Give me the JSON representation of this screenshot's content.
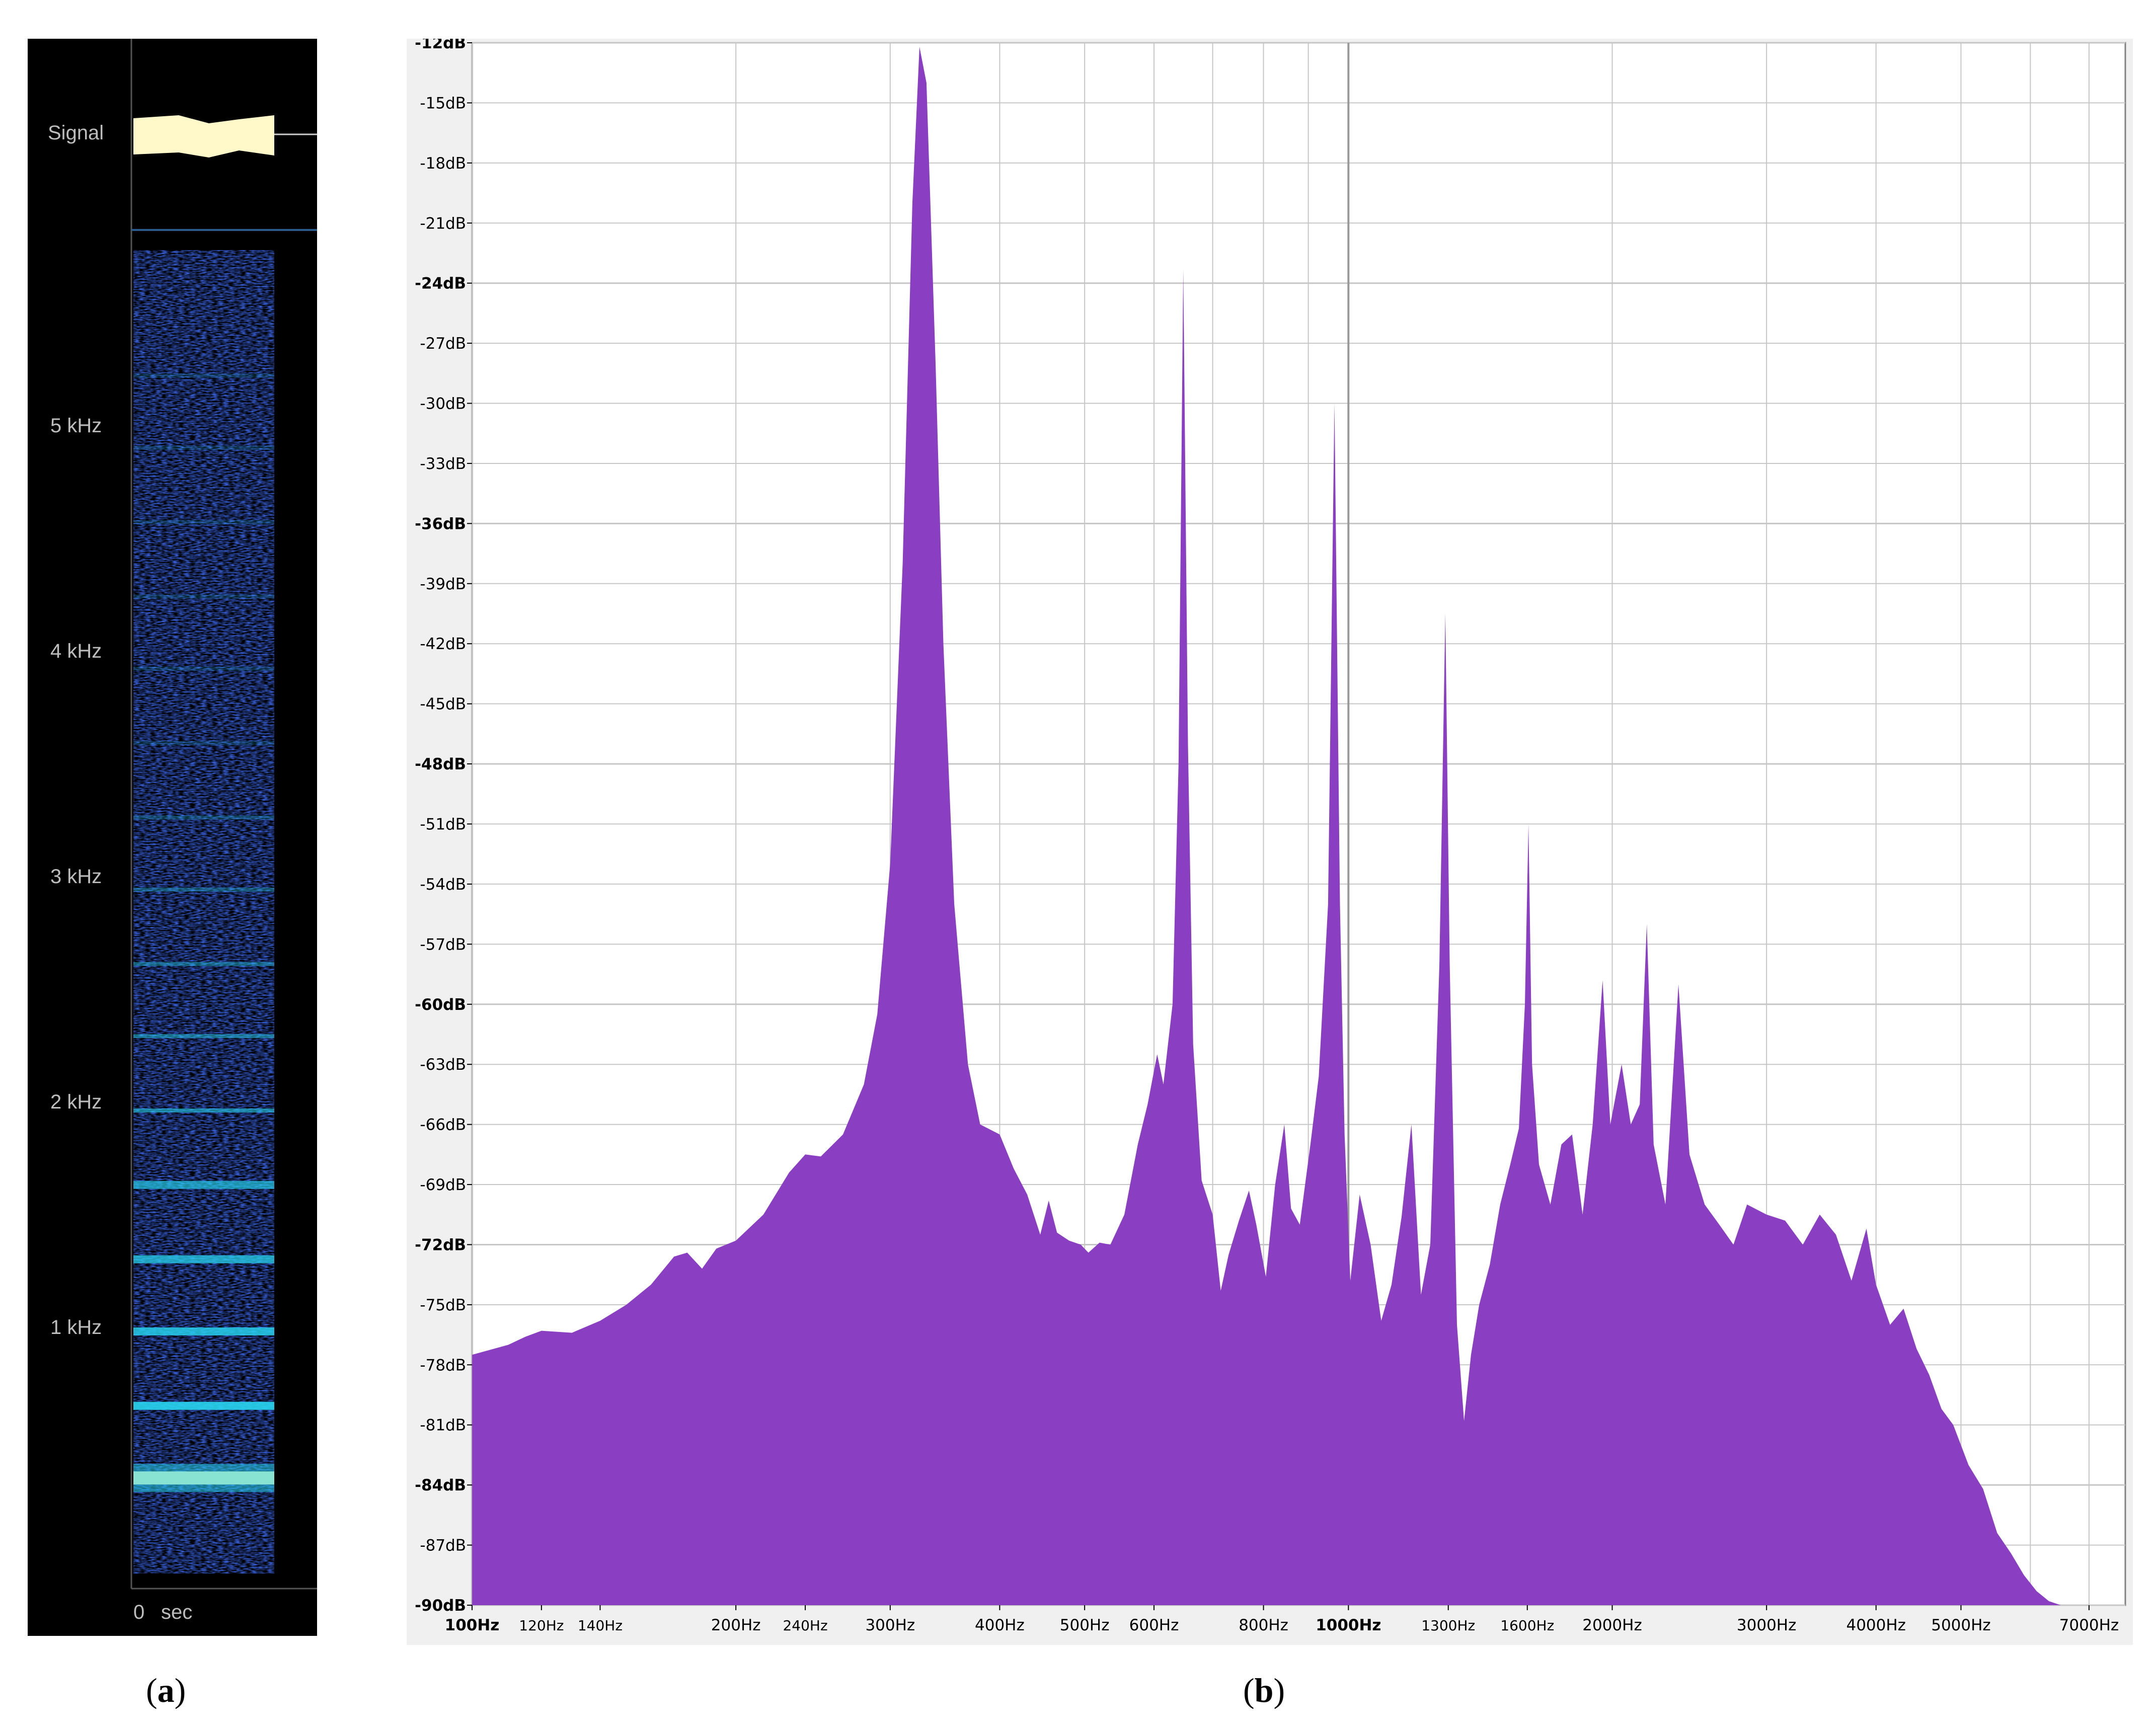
{
  "chart_data": [
    {
      "type": "heatmap",
      "panel_label": "a",
      "signal_label": "Signal",
      "y_axis": {
        "ticks": [
          {
            "value": 5,
            "label": "5 kHz"
          },
          {
            "value": 4,
            "label": "4 kHz"
          },
          {
            "value": 3,
            "label": "3 kHz"
          },
          {
            "value": 2,
            "label": "2 kHz"
          },
          {
            "value": 1,
            "label": "1 kHz"
          }
        ],
        "range_khz": [
          0,
          5.8
        ]
      },
      "x_axis": {
        "zero_label": "0",
        "unit_label": "sec"
      },
      "harmonic_bands_khz": [
        0.33,
        0.65,
        0.98,
        1.3,
        1.63,
        1.96,
        2.29,
        2.61,
        2.94,
        3.26,
        3.59,
        3.92,
        4.24,
        4.57,
        4.9,
        5.22
      ],
      "colors": {
        "background": "#000000",
        "noise": "#0a1e8c",
        "band": "#28d4f0",
        "band_strong": "#fff7b0",
        "signal": "#fff8c8"
      }
    },
    {
      "type": "area",
      "panel_label": "b",
      "x_scale": "log",
      "xlim_hz": [
        100,
        7700
      ],
      "ylim_db": [
        -90,
        -12
      ],
      "grid": true,
      "y_ticks": [
        {
          "value": -12,
          "label": "-12dB",
          "bold": true
        },
        {
          "value": -15,
          "label": "-15dB"
        },
        {
          "value": -18,
          "label": "-18dB"
        },
        {
          "value": -21,
          "label": "-21dB"
        },
        {
          "value": -24,
          "label": "-24dB",
          "bold": true
        },
        {
          "value": -27,
          "label": "-27dB"
        },
        {
          "value": -30,
          "label": "-30dB"
        },
        {
          "value": -33,
          "label": "-33dB"
        },
        {
          "value": -36,
          "label": "-36dB",
          "bold": true
        },
        {
          "value": -39,
          "label": "-39dB"
        },
        {
          "value": -42,
          "label": "-42dB"
        },
        {
          "value": -45,
          "label": "-45dB"
        },
        {
          "value": -48,
          "label": "-48dB",
          "bold": true
        },
        {
          "value": -51,
          "label": "-51dB"
        },
        {
          "value": -54,
          "label": "-54dB"
        },
        {
          "value": -57,
          "label": "-57dB"
        },
        {
          "value": -60,
          "label": "-60dB",
          "bold": true
        },
        {
          "value": -63,
          "label": "-63dB"
        },
        {
          "value": -66,
          "label": "-66dB"
        },
        {
          "value": -69,
          "label": "-69dB"
        },
        {
          "value": -72,
          "label": "-72dB",
          "bold": true
        },
        {
          "value": -75,
          "label": "-75dB"
        },
        {
          "value": -78,
          "label": "-78dB"
        },
        {
          "value": -81,
          "label": "-81dB"
        },
        {
          "value": -84,
          "label": "-84dB",
          "bold": true
        },
        {
          "value": -87,
          "label": "-87dB"
        },
        {
          "value": -90,
          "label": "-90dB",
          "bold": true
        }
      ],
      "x_ticks": [
        {
          "value": 100,
          "label": "100Hz",
          "bold": true
        },
        {
          "value": 120,
          "label": "120Hz",
          "small": true
        },
        {
          "value": 140,
          "label": "140Hz",
          "small": true
        },
        {
          "value": 200,
          "label": "200Hz"
        },
        {
          "value": 240,
          "label": "240Hz",
          "small": true
        },
        {
          "value": 300,
          "label": "300Hz"
        },
        {
          "value": 400,
          "label": "400Hz"
        },
        {
          "value": 500,
          "label": "500Hz"
        },
        {
          "value": 600,
          "label": "600Hz"
        },
        {
          "value": 800,
          "label": "800Hz"
        },
        {
          "value": 1000,
          "label": "1000Hz",
          "bold": true
        },
        {
          "value": 1300,
          "label": "1300Hz",
          "small": true
        },
        {
          "value": 1600,
          "label": "1600Hz",
          "small": true
        },
        {
          "value": 2000,
          "label": "2000Hz"
        },
        {
          "value": 3000,
          "label": "3000Hz"
        },
        {
          "value": 4000,
          "label": "4000Hz"
        },
        {
          "value": 5000,
          "label": "5000Hz"
        },
        {
          "value": 7000,
          "label": "7000Hz"
        }
      ],
      "x_grid_hz": [
        100,
        200,
        300,
        400,
        500,
        600,
        700,
        800,
        900,
        1000,
        2000,
        3000,
        4000,
        5000,
        6000,
        7000
      ],
      "spectrum_points": [
        [
          100,
          -77.5
        ],
        [
          110,
          -77.0
        ],
        [
          115,
          -76.6
        ],
        [
          120,
          -76.3
        ],
        [
          130,
          -76.4
        ],
        [
          140,
          -75.8
        ],
        [
          150,
          -75.0
        ],
        [
          160,
          -74.0
        ],
        [
          170,
          -72.6
        ],
        [
          176,
          -72.4
        ],
        [
          183,
          -73.2
        ],
        [
          190,
          -72.2
        ],
        [
          200,
          -71.8
        ],
        [
          215,
          -70.5
        ],
        [
          230,
          -68.4
        ],
        [
          240,
          -67.5
        ],
        [
          250,
          -67.6
        ],
        [
          265,
          -66.5
        ],
        [
          280,
          -64.0
        ],
        [
          290,
          -60.5
        ],
        [
          300,
          -53.0
        ],
        [
          310,
          -38.0
        ],
        [
          318,
          -20.0
        ],
        [
          324,
          -12.2
        ],
        [
          330,
          -14.0
        ],
        [
          338,
          -28.0
        ],
        [
          345,
          -42.0
        ],
        [
          355,
          -55.0
        ],
        [
          368,
          -63.0
        ],
        [
          380,
          -66.0
        ],
        [
          400,
          -66.5
        ],
        [
          415,
          -68.2
        ],
        [
          430,
          -69.5
        ],
        [
          445,
          -71.5
        ],
        [
          455,
          -69.8
        ],
        [
          465,
          -71.4
        ],
        [
          480,
          -71.8
        ],
        [
          495,
          -72.0
        ],
        [
          505,
          -72.4
        ],
        [
          520,
          -71.9
        ],
        [
          535,
          -72.0
        ],
        [
          555,
          -70.5
        ],
        [
          575,
          -67.0
        ],
        [
          590,
          -65.0
        ],
        [
          605,
          -62.5
        ],
        [
          615,
          -64.0
        ],
        [
          630,
          -60.0
        ],
        [
          640,
          -48.0
        ],
        [
          648,
          -23.3
        ],
        [
          656,
          -47.0
        ],
        [
          665,
          -62.0
        ],
        [
          680,
          -68.8
        ],
        [
          700,
          -70.5
        ],
        [
          715,
          -74.3
        ],
        [
          730,
          -72.5
        ],
        [
          750,
          -70.8
        ],
        [
          770,
          -69.3
        ],
        [
          785,
          -71.0
        ],
        [
          805,
          -73.6
        ],
        [
          825,
          -69.0
        ],
        [
          845,
          -66.0
        ],
        [
          860,
          -70.2
        ],
        [
          880,
          -71.0
        ],
        [
          905,
          -67.0
        ],
        [
          925,
          -63.6
        ],
        [
          948,
          -55.0
        ],
        [
          964,
          -30.0
        ],
        [
          978,
          -55.0
        ],
        [
          990,
          -66.5
        ],
        [
          1005,
          -73.8
        ],
        [
          1030,
          -69.5
        ],
        [
          1060,
          -72.0
        ],
        [
          1090,
          -75.8
        ],
        [
          1120,
          -74.0
        ],
        [
          1150,
          -70.6
        ],
        [
          1180,
          -66.0
        ],
        [
          1210,
          -74.5
        ],
        [
          1240,
          -72.0
        ],
        [
          1270,
          -58.0
        ],
        [
          1290,
          -40.5
        ],
        [
          1305,
          -58.0
        ],
        [
          1330,
          -76.0
        ],
        [
          1355,
          -80.8
        ],
        [
          1380,
          -77.5
        ],
        [
          1410,
          -75.0
        ],
        [
          1450,
          -73.0
        ],
        [
          1490,
          -70.0
        ],
        [
          1530,
          -68.0
        ],
        [
          1565,
          -66.2
        ],
        [
          1590,
          -60.0
        ],
        [
          1605,
          -51.0
        ],
        [
          1620,
          -63.0
        ],
        [
          1650,
          -68.0
        ],
        [
          1700,
          -70.0
        ],
        [
          1750,
          -67.0
        ],
        [
          1800,
          -66.5
        ],
        [
          1850,
          -70.5
        ],
        [
          1900,
          -66.0
        ],
        [
          1950,
          -58.8
        ],
        [
          1990,
          -66.0
        ],
        [
          2050,
          -63.0
        ],
        [
          2100,
          -66.0
        ],
        [
          2150,
          -65.0
        ],
        [
          2190,
          -56.0
        ],
        [
          2230,
          -67.0
        ],
        [
          2300,
          -70.0
        ],
        [
          2380,
          -59.0
        ],
        [
          2450,
          -67.5
        ],
        [
          2550,
          -70.0
        ],
        [
          2650,
          -71.0
        ],
        [
          2750,
          -72.0
        ],
        [
          2850,
          -70.0
        ],
        [
          3000,
          -70.5
        ],
        [
          3150,
          -70.8
        ],
        [
          3300,
          -72.0
        ],
        [
          3450,
          -70.5
        ],
        [
          3600,
          -71.5
        ],
        [
          3750,
          -73.8
        ],
        [
          3900,
          -71.2
        ],
        [
          4000,
          -74.0
        ],
        [
          4150,
          -76.0
        ],
        [
          4300,
          -75.2
        ],
        [
          4450,
          -77.2
        ],
        [
          4600,
          -78.5
        ],
        [
          4750,
          -80.2
        ],
        [
          4900,
          -81.0
        ],
        [
          5100,
          -83.0
        ],
        [
          5300,
          -84.2
        ],
        [
          5500,
          -86.4
        ],
        [
          5700,
          -87.4
        ],
        [
          5900,
          -88.5
        ],
        [
          6100,
          -89.3
        ],
        [
          6300,
          -89.8
        ],
        [
          6500,
          -90.0
        ]
      ],
      "colors": {
        "fill": "#8a3fc2",
        "grid": "#c6c6c6",
        "plot_bg": "#ffffff",
        "frame_bg": "#f0f0f0"
      }
    }
  ],
  "captions": {
    "a": "a",
    "b": "b"
  }
}
